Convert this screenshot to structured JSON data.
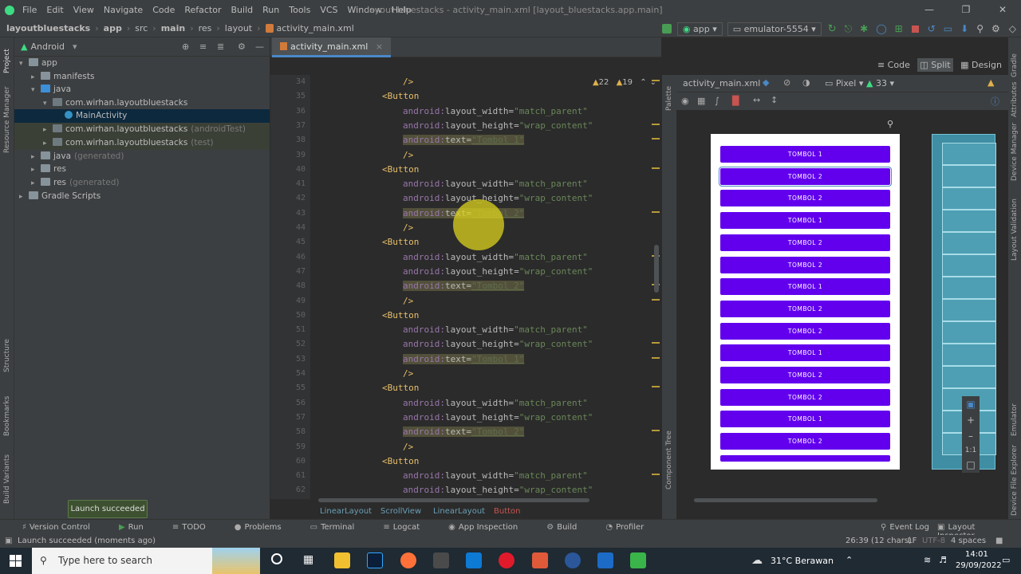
{
  "menu": {
    "items": [
      "File",
      "Edit",
      "View",
      "Navigate",
      "Code",
      "Refactor",
      "Build",
      "Run",
      "Tools",
      "VCS",
      "Window",
      "Help"
    ],
    "window_title": "layout bluestacks - activity_main.xml [layout_bluestacks.app.main]"
  },
  "breadcrumb": {
    "items": [
      "layoutbluestacks",
      "app",
      "src",
      "main",
      "res",
      "layout",
      "activity_main.xml"
    ]
  },
  "run": {
    "config": "app",
    "device": "emulator-5554"
  },
  "project": {
    "view": "Android",
    "tree": [
      {
        "label": "app",
        "depth": 0,
        "icon": "folder-icon",
        "open": true
      },
      {
        "label": "manifests",
        "depth": 1,
        "icon": "folder-icon"
      },
      {
        "label": "java",
        "depth": 1,
        "icon": "folder-icon",
        "open": true
      },
      {
        "label": "com.wirhan.layoutbluestacks",
        "depth": 2,
        "icon": "package-icon",
        "open": true
      },
      {
        "label": "MainActivity",
        "depth": 3,
        "icon": "class-icon",
        "selected": true
      },
      {
        "label": "com.wirhan.layoutbluestacks",
        "suffix": "(androidTest)",
        "depth": 2,
        "icon": "package-icon"
      },
      {
        "label": "com.wirhan.layoutbluestacks",
        "suffix": "(test)",
        "depth": 2,
        "icon": "package-icon"
      },
      {
        "label": "java",
        "suffix": "(generated)",
        "depth": 1,
        "icon": "folder-icon"
      },
      {
        "label": "res",
        "depth": 1,
        "icon": "folder-icon"
      },
      {
        "label": "res",
        "suffix": "(generated)",
        "depth": 1,
        "icon": "folder-icon"
      },
      {
        "label": "Gradle Scripts",
        "depth": 0,
        "icon": "gradle-icon"
      }
    ]
  },
  "left_strip": {
    "items": [
      "Project",
      "Resource Manager",
      "Structure",
      "Bookmarks",
      "Build Variants"
    ]
  },
  "editor": {
    "tab": "activity_main.xml",
    "warnings": "22",
    "weak_warnings": "19",
    "lines": [
      {
        "n": "34",
        "t": "close",
        "indent": 3
      },
      {
        "n": "35",
        "t": "open"
      },
      {
        "n": "36",
        "t": "attr",
        "a": "layout_width",
        "v": "\"match_parent\""
      },
      {
        "n": "37",
        "t": "attr",
        "a": "layout_height",
        "v": "\"wrap_content\""
      },
      {
        "n": "38",
        "t": "text",
        "v": "\"Tombol 1\""
      },
      {
        "n": "39",
        "t": "close"
      },
      {
        "n": "40",
        "t": "open"
      },
      {
        "n": "41",
        "t": "attr",
        "a": "layout_width",
        "v": "\"match_parent\""
      },
      {
        "n": "42",
        "t": "attr",
        "a": "layout_height",
        "v": "\"wrap_content\""
      },
      {
        "n": "43",
        "t": "text",
        "v": "\"Tombol 2\""
      },
      {
        "n": "44",
        "t": "close"
      },
      {
        "n": "45",
        "t": "open"
      },
      {
        "n": "46",
        "t": "attr",
        "a": "layout_width",
        "v": "\"match_parent\""
      },
      {
        "n": "47",
        "t": "attr",
        "a": "layout_height",
        "v": "\"wrap_content\""
      },
      {
        "n": "48",
        "t": "text",
        "v": "\"Tombol 2\""
      },
      {
        "n": "49",
        "t": "close"
      },
      {
        "n": "50",
        "t": "open"
      },
      {
        "n": "51",
        "t": "attr",
        "a": "layout_width",
        "v": "\"match_parent\""
      },
      {
        "n": "52",
        "t": "attr",
        "a": "layout_height",
        "v": "\"wrap_content\""
      },
      {
        "n": "53",
        "t": "text",
        "v": "\"Tombol 1\""
      },
      {
        "n": "54",
        "t": "close"
      },
      {
        "n": "55",
        "t": "open"
      },
      {
        "n": "56",
        "t": "attr",
        "a": "layout_width",
        "v": "\"match_parent\""
      },
      {
        "n": "57",
        "t": "attr",
        "a": "layout_height",
        "v": "\"wrap_content\""
      },
      {
        "n": "58",
        "t": "text",
        "v": "\"Tombol 2\""
      },
      {
        "n": "59",
        "t": "close"
      },
      {
        "n": "60",
        "t": "open"
      },
      {
        "n": "61",
        "t": "attr",
        "a": "layout_width",
        "v": "\"match_parent\""
      },
      {
        "n": "62",
        "t": "attr",
        "a": "layout_height",
        "v": "\"wrap_content\""
      }
    ],
    "tag_button": "<Button",
    "tag_close": "/>",
    "ns": "android:",
    "text_attr": "text=",
    "breadcrumbs": [
      "LinearLayout",
      "ScrollView",
      "LinearLayout",
      "Button"
    ]
  },
  "design": {
    "modes": [
      "Code",
      "Split",
      "Design"
    ],
    "file": "activity_main.xml",
    "device": "Pixel",
    "api": "33",
    "buttons": [
      "TOMBOL 1",
      "TOMBOL 2",
      "TOMBOL 2",
      "TOMBOL 1",
      "TOMBOL 2",
      "TOMBOL 2",
      "TOMBOL 1",
      "TOMBOL 2",
      "TOMBOL 2",
      "TOMBOL 1",
      "TOMBOL 2",
      "TOMBOL 2",
      "TOMBOL 1",
      "TOMBOL 2"
    ],
    "side_labels": [
      "Palette",
      "Component Tree"
    ],
    "zoom_one": "1:1"
  },
  "right_strip": {
    "items": [
      "Gradle",
      "Attributes",
      "Device Manager",
      "Layout Validation",
      "Emulator",
      "Device File Explorer"
    ]
  },
  "bottom_tools": [
    "Version Control",
    "Run",
    "TODO",
    "Problems",
    "Terminal",
    "Logcat",
    "App Inspection",
    "Build",
    "Profiler",
    "Event Log",
    "Layout Inspector"
  ],
  "status": {
    "message": "Launch succeeded (moments ago)",
    "position": "26:39 (12 chars)",
    "line_sep": "LF",
    "encoding": "UTF-8",
    "indent": "4 spaces"
  },
  "toast": "Launch succeeded",
  "taskbar": {
    "search": "Type here to search",
    "weather": "31°C Berawan",
    "time": "14:01",
    "date": "29/09/2022"
  },
  "colors": {
    "accent": "#4a88c7",
    "button": "#6200ee",
    "run_green": "#499c54"
  }
}
